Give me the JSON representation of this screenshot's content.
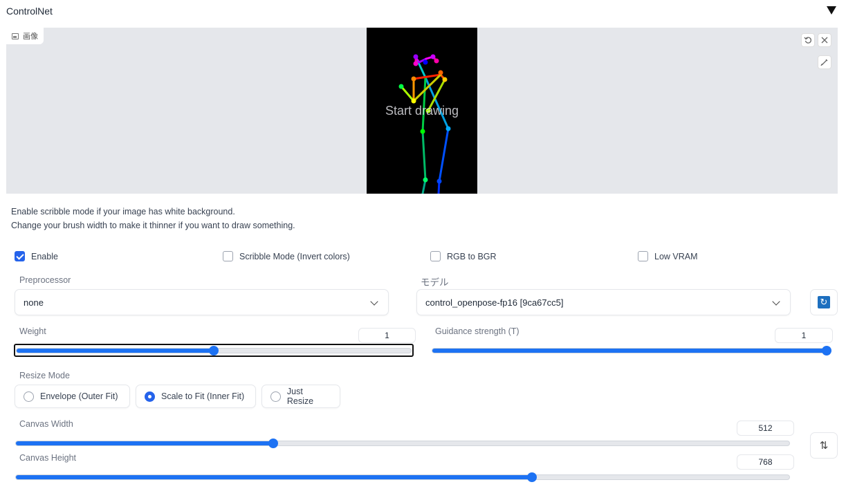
{
  "header": {
    "title": "ControlNet"
  },
  "image_panel": {
    "label": "画像",
    "placeholder": "Start drawing",
    "tools": {
      "undo_icon": "undo-icon",
      "clear_icon": "close-icon",
      "brush_icon": "brush-icon"
    }
  },
  "hints": {
    "line1": "Enable scribble mode if your image has white background.",
    "line2": "Change your brush width to make it thinner if you want to draw something."
  },
  "checkboxes": [
    {
      "label": "Enable",
      "checked": true
    },
    {
      "label": "Scribble Mode (Invert colors)",
      "checked": false
    },
    {
      "label": "RGB to BGR",
      "checked": false
    },
    {
      "label": "Low VRAM",
      "checked": false
    }
  ],
  "preprocessor": {
    "label": "Preprocessor",
    "value": "none"
  },
  "model": {
    "label": "モデル",
    "value": "control_openpose-fp16 [9ca67cc5]"
  },
  "weight": {
    "label": "Weight",
    "value": "1",
    "fraction": 0.5
  },
  "guidance": {
    "label": "Guidance strength (T)",
    "value": "1",
    "fraction": 1.0
  },
  "resize_mode": {
    "label": "Resize Mode",
    "options": [
      "Envelope (Outer Fit)",
      "Scale to Fit (Inner Fit)",
      "Just Resize"
    ],
    "selected": "Scale to Fit (Inner Fit)"
  },
  "canvas_width": {
    "label": "Canvas Width",
    "value": "512",
    "fraction": 0.333
  },
  "canvas_height": {
    "label": "Canvas Height",
    "value": "768",
    "fraction": 0.667
  },
  "colors": {
    "accent": "#1d72f3",
    "checkbox": "#2563eb",
    "canvas_bg": "#e5e7eb"
  }
}
